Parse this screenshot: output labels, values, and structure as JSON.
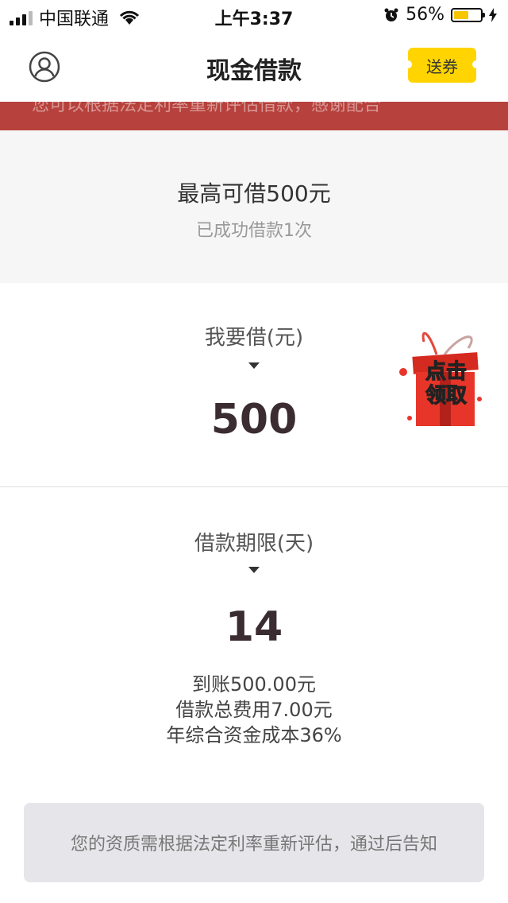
{
  "status_bar": {
    "carrier": "中国联通",
    "time": "上午3:37",
    "battery": "56%",
    "battery_level": 0.56
  },
  "nav": {
    "title": "现金借款",
    "coupon_label": "送券"
  },
  "notice": {
    "text": "您可以根据法定利率重新评估借款，感谢配合"
  },
  "limit": {
    "title": "最高可借500元",
    "subtitle": "已成功借款1次"
  },
  "amount": {
    "label": "我要借(元)",
    "value": "500"
  },
  "gift": {
    "line1": "点击",
    "line2": "领取"
  },
  "term": {
    "label": "借款期限(天)",
    "value": "14",
    "arrival": "到账500.00元",
    "total_fee": "借款总费用7.00元",
    "annual_cost": "年综合资金成本36%"
  },
  "action": {
    "label": "您的资质需根据法定利率重新评估，通过后告知"
  }
}
